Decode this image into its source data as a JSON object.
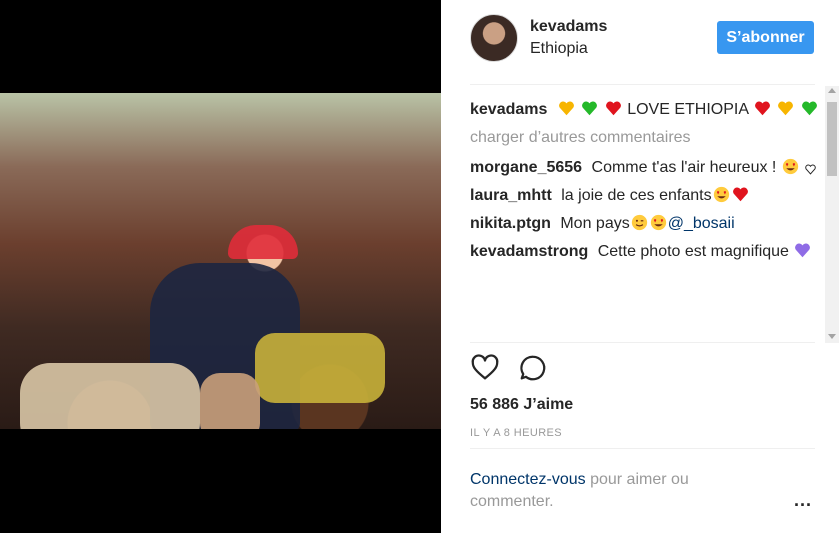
{
  "post": {
    "username": "kevadams",
    "location": "Ethiopia",
    "follow_label": "S’abonner"
  },
  "caption": {
    "username": "kevadams",
    "text": "LOVE ETHIOPIA",
    "emoji_before": [
      "yellow-heart",
      "green-heart",
      "red-heart"
    ],
    "emoji_after": [
      "red-heart",
      "yellow-heart",
      "green-heart"
    ]
  },
  "comments_ui": {
    "load_more": "charger d’autres commentaires"
  },
  "comments": [
    {
      "username": "morgane_5656",
      "text": "Comme t'as l'air heureux !",
      "emoji": [
        "heart-eyes",
        "white-heart"
      ]
    },
    {
      "username": "laura_mhtt",
      "text": "la joie de ces enfants",
      "emoji": [
        "heart-eyes",
        "red-heart"
      ]
    },
    {
      "username": "nikita.ptgn",
      "text": "Mon pays",
      "emoji": [
        "wink-smile",
        "heart-eyes"
      ],
      "mention": "@_bosaii"
    },
    {
      "username": "kevadamstrong",
      "text": "Cette photo est magnifique",
      "emoji": [
        "purple-heart"
      ]
    }
  ],
  "actions": {
    "like_icon": "heart-outline-icon",
    "comment_icon": "speech-bubble-icon"
  },
  "likes_text": "56 886 J’aime",
  "time_text": "IL Y A 8 HEURES",
  "login": {
    "link": "Connectez-vous",
    "rest": "pour aimer ou commenter."
  },
  "more_label": "...",
  "colors": {
    "follow_bg": "#3897f0",
    "muted": "#999999",
    "link": "#003569",
    "yellow_heart": "#f7b500",
    "green_heart": "#25b92a",
    "red_heart": "#e0141e",
    "purple_heart": "#8f6ce6"
  }
}
